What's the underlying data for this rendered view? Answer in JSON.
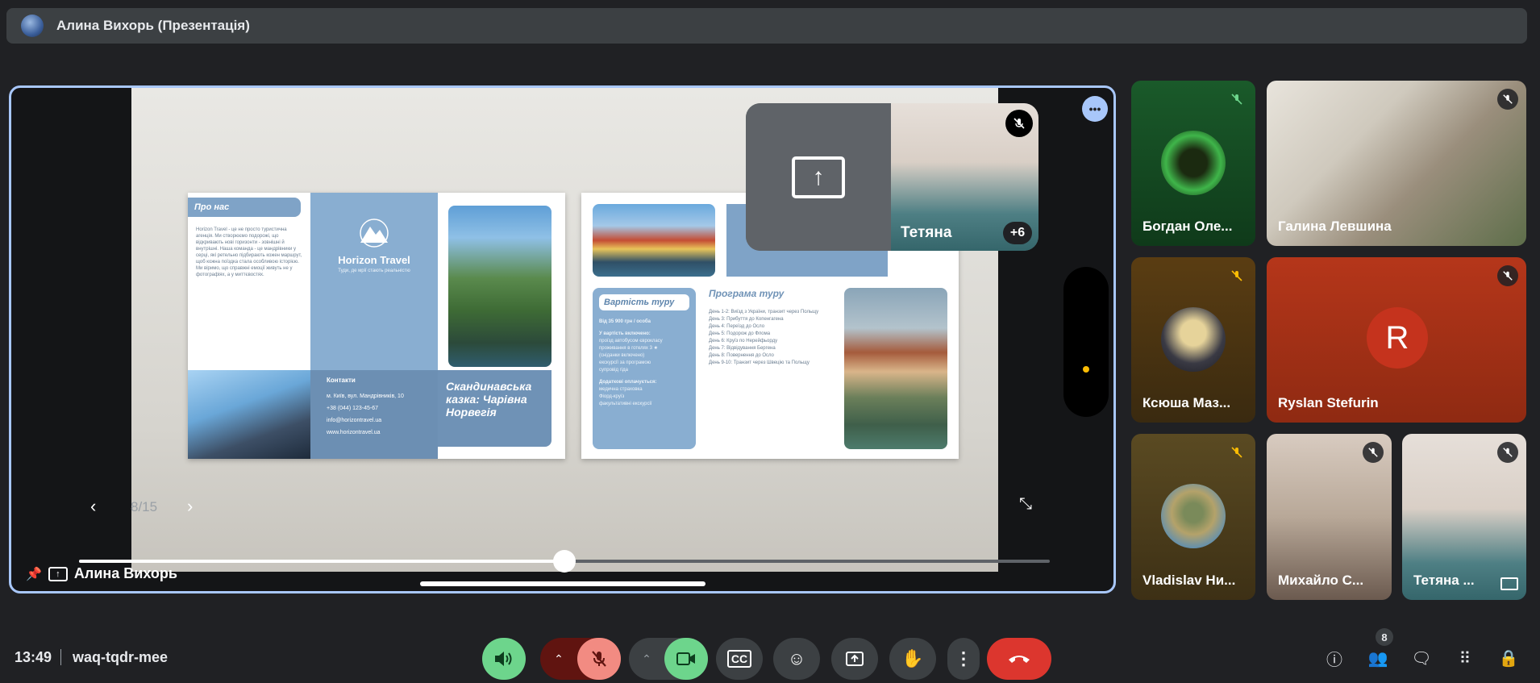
{
  "window": {
    "title": "Алина Вихорь (Презентація)"
  },
  "presentation": {
    "page_indicator": "8/15",
    "progress_fraction": 0.5,
    "presenter_name": "Алина Вихорь",
    "slide": {
      "about_header": "Про нас",
      "about_text": "Horizon Travel - це не просто туристична агенція. Ми створюємо подорожі, що відкривають нові горизонти - зовнішні й внутрішні. Наша команда - це мандрівники у серці, які ретельно підбирають кожен маршрут, щоб кожна поїздка стала особливою історією. Ми віримо, що справжні емоції живуть не у фотографіях, а у миттєвостях.",
      "brand": "Horizon Travel",
      "tagline": "Туди, де мрії стають реальністю",
      "contacts_header": "Контакти",
      "contacts_lines": [
        "м. Київ, вул. Мандрівників, 10",
        "+38 (044) 123-45-67",
        "info@horizontravel.ua",
        "www.horizontravel.ua"
      ],
      "title": "Скандинавська казка: Чарівна Норвегія",
      "price_header": "Вартість туру",
      "price_lines": [
        "Від 35 900 грн / особа",
        "У вартість включено:",
        "проїзд автобусом єврокласу",
        "проживання в готелях 3 ★",
        "(сніданки включено)",
        "екскурсії за програмою",
        "супровід гіда",
        "Додаткові оплачується:",
        "медична страховка",
        "Фіорд-круїз",
        "факультативні екскурсії"
      ],
      "program_header": "Програма туру",
      "program_lines": [
        "День 1-2: Виїзд з України, транзит через Польщу",
        "День 3: Прибуття до Копенгагена",
        "День 4: Переїзд до Осло",
        "День 5: Подорож до Флома",
        "День 6: Круїз по Нерейфьорду",
        "День 7: Відвідування Бергена",
        "День 8: Повернення до Осло",
        "День 9-10: Транзит через Швецію та Польщу"
      ]
    }
  },
  "self_tile": {
    "name": "Тетяна",
    "overflow": "+6"
  },
  "participants": [
    {
      "name": "Богдан Оле..."
    },
    {
      "name": "Галина Левшина"
    },
    {
      "name": "Ксюша Маз..."
    },
    {
      "name": "Ryslan Stefurin",
      "initial": "R"
    },
    {
      "name": "Vladislav Ни..."
    },
    {
      "name": "Михайло С..."
    },
    {
      "name": "Тетяна ..."
    }
  ],
  "meeting": {
    "time": "13:49",
    "code": "waq-tqdr-mee",
    "participant_count": "8"
  },
  "colors": {
    "accent": "#a8c7fa",
    "end_call": "#dc362e",
    "active_green": "#6dd58c",
    "muted_red": "#f28b82"
  }
}
